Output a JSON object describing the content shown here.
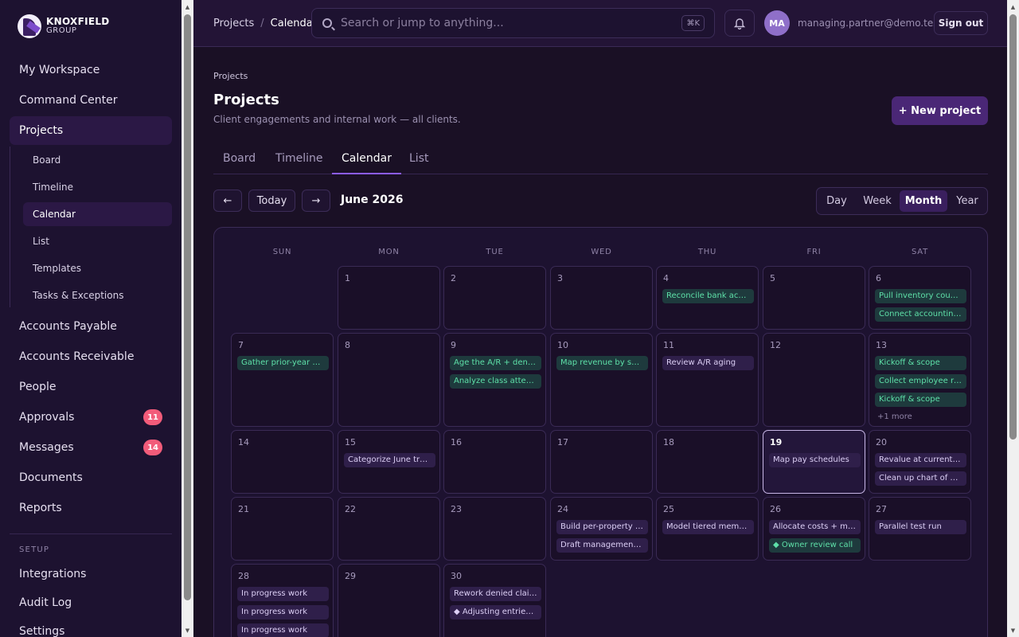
{
  "brand": {
    "line1": "KNOXFIELD",
    "line2": "GROUP"
  },
  "sidebar": {
    "items": [
      {
        "label": "My Workspace"
      },
      {
        "label": "Command Center"
      },
      {
        "label": "Projects"
      },
      {
        "label": "Accounts Payable"
      },
      {
        "label": "Accounts Receivable"
      },
      {
        "label": "People"
      },
      {
        "label": "Approvals",
        "badge": "11"
      },
      {
        "label": "Messages",
        "badge": "14"
      },
      {
        "label": "Documents"
      },
      {
        "label": "Reports"
      }
    ],
    "sub_items": [
      {
        "label": "Board"
      },
      {
        "label": "Timeline"
      },
      {
        "label": "Calendar"
      },
      {
        "label": "List"
      },
      {
        "label": "Templates"
      },
      {
        "label": "Tasks & Exceptions"
      }
    ],
    "setup_label": "SETUP",
    "setup_items": [
      {
        "label": "Integrations"
      },
      {
        "label": "Audit Log"
      },
      {
        "label": "Settings"
      }
    ]
  },
  "header": {
    "breadcrumb": [
      "Projects",
      "/",
      "Calendar"
    ],
    "search_placeholder": "Search or jump to anything...",
    "shortcut": "⌘K",
    "avatar_initials": "MA",
    "user_email": "managing.partner@demo.test",
    "signout_label": "Sign out"
  },
  "page": {
    "crumb": "Projects",
    "title": "Projects",
    "subtitle": "Client engagements and internal work — all clients.",
    "new_button": "+ New project",
    "tabs": [
      "Board",
      "Timeline",
      "Calendar",
      "List"
    ],
    "active_tab": "Calendar"
  },
  "calendar": {
    "prev_label": "←",
    "today_label": "Today",
    "next_label": "→",
    "month_label": "June 2026",
    "views": [
      "Day",
      "Week",
      "Month",
      "Year"
    ],
    "active_view": "Month",
    "weekdays": [
      "SUN",
      "MON",
      "TUE",
      "WED",
      "THU",
      "FRI",
      "SAT"
    ],
    "today": "19",
    "weeks": [
      [
        null,
        {
          "day": "1",
          "events": []
        },
        {
          "day": "2",
          "events": []
        },
        {
          "day": "3",
          "events": []
        },
        {
          "day": "4",
          "events": [
            {
              "text": "Reconcile bank accounts",
              "style": "green"
            }
          ]
        },
        {
          "day": "5",
          "events": []
        },
        {
          "day": "6",
          "events": [
            {
              "text": "Pull inventory counts",
              "style": "green"
            },
            {
              "text": "Connect accounting + payroll",
              "style": "green"
            }
          ]
        }
      ],
      [
        {
          "day": "7",
          "events": [
            {
              "text": "Gather prior-year activity",
              "style": "green"
            }
          ]
        },
        {
          "day": "8",
          "events": []
        },
        {
          "day": "9",
          "events": [
            {
              "text": "Age the A/R + denials",
              "style": "green"
            },
            {
              "text": "Analyze class attendance",
              "style": "green"
            }
          ]
        },
        {
          "day": "10",
          "events": [
            {
              "text": "Map revenue by service",
              "style": "green"
            }
          ]
        },
        {
          "day": "11",
          "events": [
            {
              "text": "Review A/R aging",
              "style": "purple"
            }
          ]
        },
        {
          "day": "12",
          "events": []
        },
        {
          "day": "13",
          "events": [
            {
              "text": "Kickoff & scope",
              "style": "green"
            },
            {
              "text": "Collect employee records",
              "style": "green"
            },
            {
              "text": "Kickoff & scope",
              "style": "green"
            }
          ],
          "more": "+1 more"
        }
      ],
      [
        {
          "day": "14",
          "events": []
        },
        {
          "day": "15",
          "events": [
            {
              "text": "Categorize June transactions",
              "style": "purple"
            }
          ]
        },
        {
          "day": "16",
          "events": []
        },
        {
          "day": "17",
          "events": []
        },
        {
          "day": "18",
          "events": []
        },
        {
          "day": "19",
          "events": [
            {
              "text": "Map pay schedules",
              "style": "purple"
            }
          ]
        },
        {
          "day": "20",
          "events": [
            {
              "text": "Revalue at current goods",
              "style": "purple"
            },
            {
              "text": "Clean up chart of accounts",
              "style": "purple"
            }
          ]
        }
      ],
      [
        {
          "day": "21",
          "events": []
        },
        {
          "day": "22",
          "events": []
        },
        {
          "day": "23",
          "events": []
        },
        {
          "day": "24",
          "events": [
            {
              "text": "Build per-property budgets",
              "style": "purple"
            },
            {
              "text": "Draft management report",
              "style": "purple"
            }
          ]
        },
        {
          "day": "25",
          "events": [
            {
              "text": "Model tiered membership",
              "style": "purple"
            }
          ]
        },
        {
          "day": "26",
          "events": [
            {
              "text": "Allocate costs + margins",
              "style": "purple"
            },
            {
              "text": "◆ Owner review call",
              "style": "green"
            }
          ]
        },
        {
          "day": "27",
          "events": [
            {
              "text": "Parallel test run",
              "style": "purple"
            }
          ]
        }
      ],
      [
        {
          "day": "28",
          "events": [
            {
              "text": "In progress work",
              "style": "purple"
            },
            {
              "text": "In progress work",
              "style": "purple"
            },
            {
              "text": "In progress work",
              "style": "purple"
            }
          ]
        },
        {
          "day": "29",
          "events": []
        },
        {
          "day": "30",
          "events": [
            {
              "text": "Rework denied claims",
              "style": "purple"
            },
            {
              "text": "◆ Adjusting entries + close",
              "style": "purple"
            }
          ]
        },
        null,
        null,
        null,
        null
      ]
    ]
  }
}
